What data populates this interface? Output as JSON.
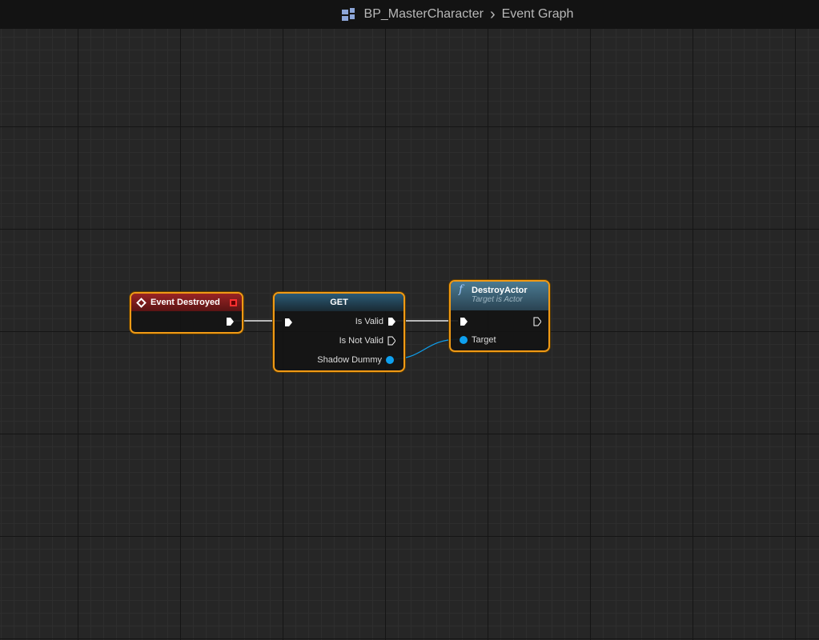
{
  "header": {
    "blueprint": "BP_MasterCharacter",
    "separator": "›",
    "graph": "Event Graph"
  },
  "nodes": {
    "event_destroyed": {
      "title": "Event Destroyed"
    },
    "get": {
      "title": "GET",
      "outputs": [
        "Is Valid",
        "Is Not Valid",
        "Shadow Dummy"
      ]
    },
    "destroy_actor": {
      "title": "DestroyActor",
      "subtitle": "Target is Actor",
      "input": "Target"
    }
  },
  "colors": {
    "selection": "#f09a16",
    "event_header": "#8b1d1d",
    "function_header": "#3f6a80",
    "object_pin": "#0ea0ef"
  }
}
